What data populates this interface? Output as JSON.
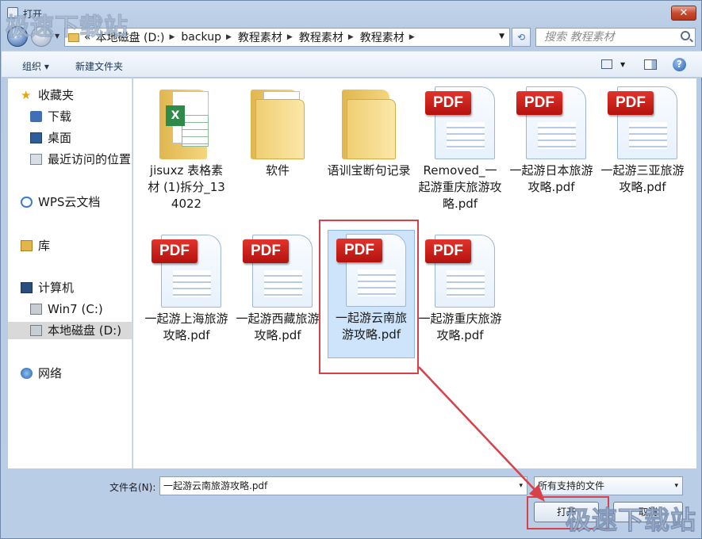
{
  "window": {
    "title": "打开",
    "close_glyph": "✕"
  },
  "address": {
    "back_glyph": "←",
    "forward_glyph": "→",
    "breadcrumbs": [
      "«",
      "本地磁盘 (D:)",
      "backup",
      "教程素材",
      "教程素材",
      "教程素材"
    ],
    "refresh_glyph": "⟲",
    "search_placeholder": "搜索 教程素材"
  },
  "toolbar": {
    "organize": "组织 ▾",
    "new_folder": "新建文件夹",
    "help_glyph": "?"
  },
  "nav": {
    "favorites": "收藏夹",
    "downloads": "下载",
    "desktop": "桌面",
    "recent": "最近访问的位置",
    "wps": "WPS云文档",
    "libraries": "库",
    "computer": "计算机",
    "drive_c": "Win7 (C:)",
    "drive_d": "本地磁盘 (D:)",
    "network": "网络"
  },
  "files": [
    {
      "name": "jisuxz 表格素材 (1)拆分_134022",
      "type": "folder-excel"
    },
    {
      "name": "软件",
      "type": "folder"
    },
    {
      "name": "语训宝断句记录",
      "type": "folder"
    },
    {
      "name": "Removed_一起游重庆旅游攻略.pdf",
      "type": "pdf"
    },
    {
      "name": "一起游日本旅游攻略.pdf",
      "type": "pdf"
    },
    {
      "name": "一起游三亚旅游攻略.pdf",
      "type": "pdf"
    },
    {
      "name": "一起游上海旅游攻略.pdf",
      "type": "pdf"
    },
    {
      "name": "一起游西藏旅游攻略.pdf",
      "type": "pdf"
    },
    {
      "name": "一起游云南旅游攻略.pdf",
      "type": "pdf",
      "selected": true
    },
    {
      "name": "一起游重庆旅游攻略.pdf",
      "type": "pdf"
    }
  ],
  "pdf_badge": "PDF",
  "excel_badge": "X",
  "bottom": {
    "filename_label": "文件名(N):",
    "filename_value": "一起游云南旅游攻略.pdf",
    "filter_value": "所有支持的文件",
    "open_label": "打开",
    "cancel_label": "取消",
    "drop_glyph": "▾"
  },
  "watermark": "极速下载站",
  "annotation_color": "#d8414a"
}
